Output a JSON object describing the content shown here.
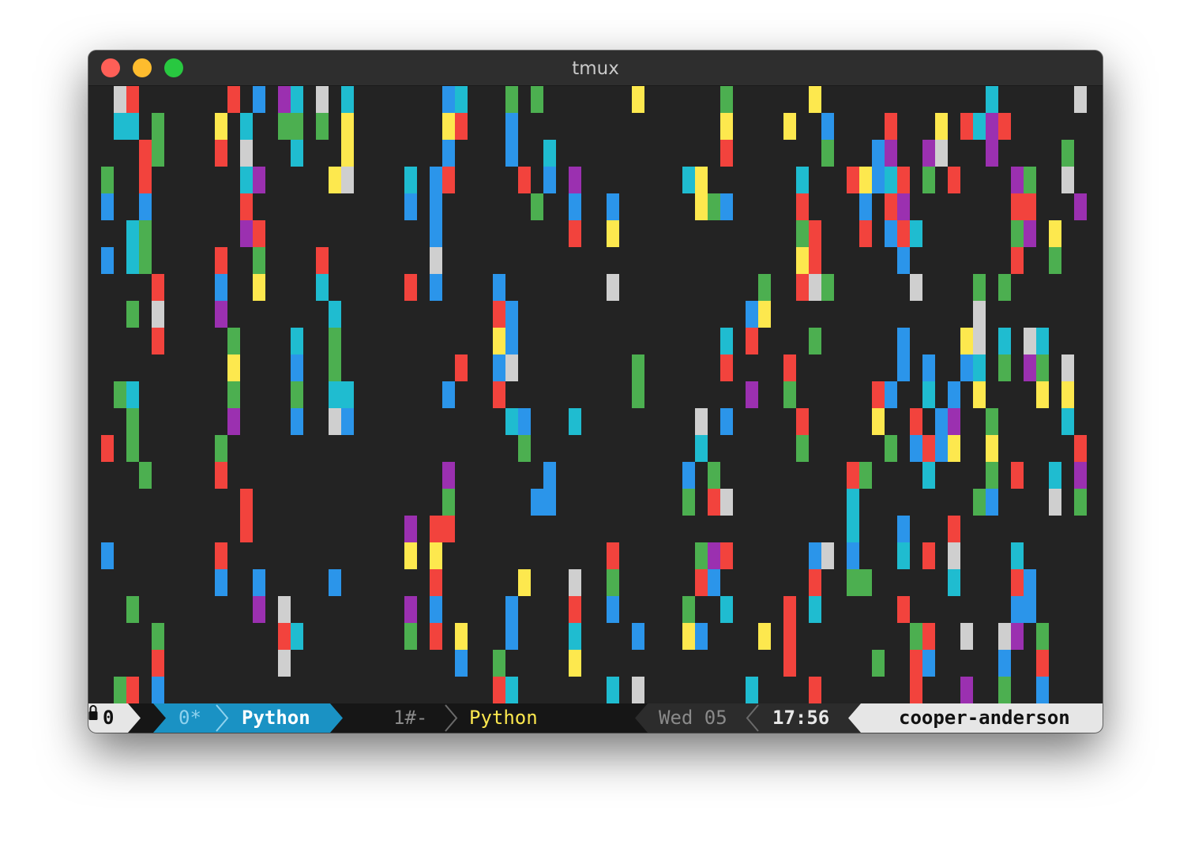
{
  "window": {
    "title": "tmux"
  },
  "status": {
    "session": "0",
    "windows": [
      {
        "index": "0*",
        "name": "Python",
        "active": true
      },
      {
        "index": "1#-",
        "name": "Python",
        "active": false
      }
    ],
    "date": "Wed 05",
    "time": "17:56",
    "host": "cooper-anderson"
  },
  "colors": {
    "background": "#232323",
    "red": "#f2433d",
    "green": "#4caf50",
    "blue": "#2b95ea",
    "cyan": "#1fbcd0",
    "yellow": "#fde84e",
    "purple": "#9b30b0",
    "gray": "#cfcfcf",
    "active_tab": "#1a92c4"
  },
  "icons": {
    "lock": "lock-icon"
  }
}
